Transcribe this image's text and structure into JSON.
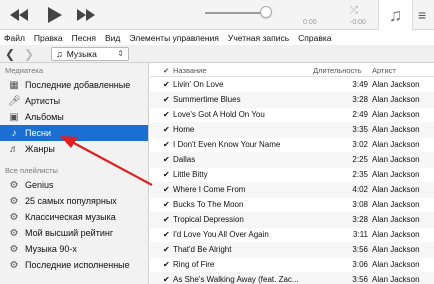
{
  "player": {
    "prev_icon": "rewind-icon",
    "play_icon": "play-icon",
    "next_icon": "fast-forward-icon",
    "time_left": "0:00",
    "time_right": "-0:00",
    "art_icon": "music-note-icon"
  },
  "menubar": [
    "Файл",
    "Правка",
    "Песня",
    "Вид",
    "Элементы управления",
    "Учетная запись",
    "Справка"
  ],
  "toolbar": {
    "library_label": "Музыка"
  },
  "sidebar": {
    "library_header": "Медиатека",
    "library_items": [
      {
        "label": "Последние добавленные",
        "icon": "grid-icon"
      },
      {
        "label": "Артисты",
        "icon": "microphone-icon"
      },
      {
        "label": "Альбомы",
        "icon": "album-icon"
      },
      {
        "label": "Песни",
        "icon": "music-note-icon",
        "selected": true
      },
      {
        "label": "Жанры",
        "icon": "genres-icon"
      }
    ],
    "playlists_header": "Все плейлисты",
    "playlist_items": [
      {
        "label": "Genius"
      },
      {
        "label": "25 самых популярных"
      },
      {
        "label": "Классическая музыка"
      },
      {
        "label": "Мой высший рейтинг"
      },
      {
        "label": "Музыка 90-х"
      },
      {
        "label": "Последние исполненные"
      }
    ]
  },
  "songlist": {
    "columns": {
      "name": "Название",
      "duration": "Длительность",
      "artist": "Артист"
    },
    "songs": [
      {
        "title": "Livin' On Love",
        "duration": "3:49",
        "artist": "Alan Jackson"
      },
      {
        "title": "Summertime Blues",
        "duration": "3:28",
        "artist": "Alan Jackson"
      },
      {
        "title": "Love's Got A Hold On You",
        "duration": "2:49",
        "artist": "Alan Jackson"
      },
      {
        "title": "Home",
        "duration": "3:35",
        "artist": "Alan Jackson"
      },
      {
        "title": "I Don't Even Know Your Name",
        "duration": "3:02",
        "artist": "Alan Jackson"
      },
      {
        "title": "Dallas",
        "duration": "2:25",
        "artist": "Alan Jackson"
      },
      {
        "title": "Little Bitty",
        "duration": "2:35",
        "artist": "Alan Jackson"
      },
      {
        "title": "Where I Come From",
        "duration": "4:02",
        "artist": "Alan Jackson"
      },
      {
        "title": "Bucks To The Moon",
        "duration": "3:08",
        "artist": "Alan Jackson"
      },
      {
        "title": "Tropical Depression",
        "duration": "3:28",
        "artist": "Alan Jackson"
      },
      {
        "title": "I'd Love You All Over Again",
        "duration": "3:11",
        "artist": "Alan Jackson"
      },
      {
        "title": "That'd Be Alright",
        "duration": "3:56",
        "artist": "Alan Jackson"
      },
      {
        "title": "Ring of Fire",
        "duration": "3:06",
        "artist": "Alan Jackson"
      },
      {
        "title": "As She's Walking Away (feat. Zac...",
        "duration": "3:56",
        "artist": "Alan Jackson"
      }
    ]
  },
  "colors": {
    "selection": "#1c6fd2",
    "arrow": "#e02020"
  }
}
